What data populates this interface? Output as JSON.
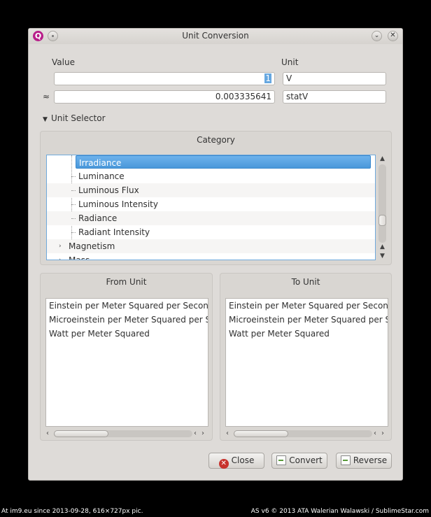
{
  "window": {
    "title": "Unit Conversion",
    "app_icon_letter": "Q",
    "minimize_glyph": "⌄",
    "close_glyph": "✕"
  },
  "conversion": {
    "value_label": "Value",
    "unit_label": "Unit",
    "approx_symbol": "≈",
    "input_value": "1",
    "input_unit": "V",
    "result_value": "0.003335641",
    "result_unit": "statV"
  },
  "unit_selector": {
    "toggle_label": "Unit Selector",
    "category": {
      "title": "Category",
      "items": [
        {
          "label": "Irradiance",
          "level": 2,
          "selected": true
        },
        {
          "label": "Luminance",
          "level": 2,
          "selected": false
        },
        {
          "label": "Luminous Flux",
          "level": 2,
          "selected": false
        },
        {
          "label": "Luminous Intensity",
          "level": 2,
          "selected": false
        },
        {
          "label": "Radiance",
          "level": 2,
          "selected": false
        },
        {
          "label": "Radiant Intensity",
          "level": 2,
          "selected": false
        },
        {
          "label": "Magnetism",
          "level": 1,
          "selected": false
        },
        {
          "label": "Mass",
          "level": 1,
          "selected": false
        }
      ]
    },
    "from_unit": {
      "title": "From Unit",
      "items": [
        "Einstein per Meter Squared per Second",
        "Microeinstein per Meter Squared per Second",
        "Watt per Meter Squared"
      ]
    },
    "to_unit": {
      "title": "To Unit",
      "items": [
        "Einstein per Meter Squared per Second",
        "Microeinstein per Meter Squared per Second",
        "Watt per Meter Squared"
      ]
    }
  },
  "buttons": {
    "close": "Close",
    "convert": "Convert",
    "reverse": "Reverse"
  },
  "footer": {
    "left": "At im9.eu  since 2013-09-28, 616×727px pic.",
    "right": "AS v6 © 2013 ATA Walerian Walawski / SublimeStar.com"
  }
}
